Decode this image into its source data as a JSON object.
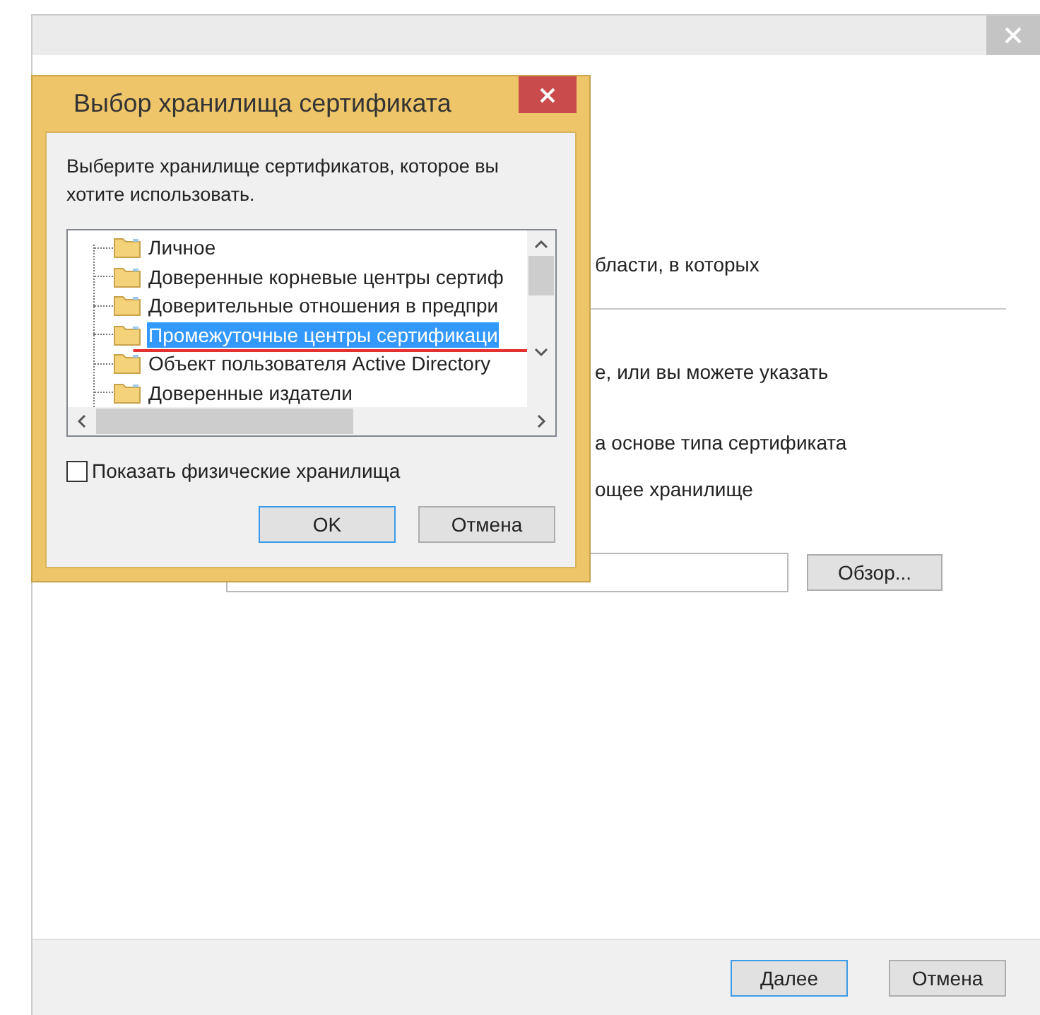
{
  "background_texts": [
    "бласти, в которых",
    "е, или вы можете указать",
    "а основе типа сертификата",
    "ощее хранилище"
  ],
  "browse_button": "Обзор...",
  "footer_buttons": [
    {
      "label": "Далее",
      "default": true
    },
    {
      "label": "Отмена",
      "default": false
    }
  ],
  "dialog": {
    "title": "Выбор хранилища сертификата",
    "prompt": "Выберите хранилище сертификатов, которое вы хотите использовать.",
    "stores": [
      {
        "label": "Личное",
        "selected": false
      },
      {
        "label": "Доверенные корневые центры сертиф",
        "selected": false
      },
      {
        "label": "Доверительные отношения в предпри",
        "selected": false
      },
      {
        "label": "Промежуточные центры сертификаци",
        "selected": true
      },
      {
        "label": "Объект пользователя Active Directory",
        "selected": false
      },
      {
        "label": "Доверенные издатели",
        "selected": false
      }
    ],
    "show_physical": {
      "label": "Показать физические хранилища",
      "checked": false
    },
    "buttons": [
      {
        "label": "OK",
        "default": true
      },
      {
        "label": "Отмена",
        "default": false
      }
    ]
  }
}
